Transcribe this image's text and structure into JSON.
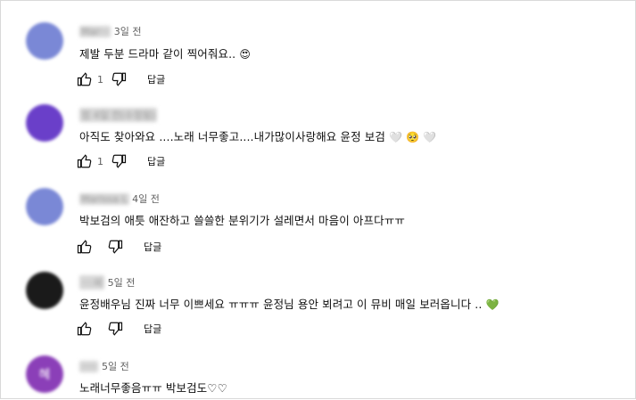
{
  "comments": [
    {
      "author": "Mar··· ",
      "time": "3일 전",
      "text": "제발 두분 드라마 같이 찍어줘요..",
      "emoji": "😍",
      "likes": "1",
      "reply_label": "답글",
      "avatar_color": "#7a88d6",
      "avatar_letter": ""
    },
    {
      "author": "정 4일 전(수정됨)",
      "time": "",
      "text": "아직도 찾아와요 ....노래 너무좋고....내가많이사랑해요 윤정 보검",
      "emoji": "🤍 🥺 🤍",
      "likes": "1",
      "reply_label": "답글",
      "avatar_color": "#6a3fc9",
      "avatar_letter": ""
    },
    {
      "author": "Marissa L",
      "time": "4일 전",
      "text": "박보검의 애틋 애잔하고 쓸쓸한 분위기가 설레면서 마음이 아프다ㅠㅠ",
      "emoji": "",
      "likes": "",
      "reply_label": "답글",
      "avatar_color": "#7a88d6",
      "avatar_letter": ""
    },
    {
      "author": "····씨",
      "time": "5일 전",
      "text": "윤정배우님 진짜 너무 이쁘세요 ㅠㅠㅠ 윤정님 용안 뵈려고 이 뮤비 매일 보러옵니다 ..",
      "emoji": "💚",
      "likes": "",
      "reply_label": "답글",
      "avatar_color": "#1a1a1a",
      "avatar_letter": ""
    },
    {
      "author": "·····",
      "time": "5일 전",
      "text": "노래너무좋음ㅠㅠ 박보검도♡♡",
      "emoji": "",
      "likes": "",
      "reply_label": "",
      "avatar_color": "#8b3fb8",
      "avatar_letter": "혜"
    }
  ]
}
